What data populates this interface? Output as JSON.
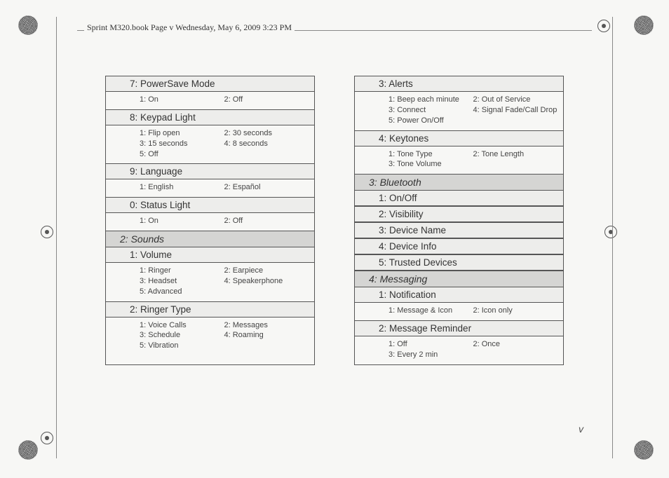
{
  "header": "Sprint M320.book  Page v  Wednesday, May 6, 2009  3:23 PM",
  "page_number": "v",
  "left": {
    "subs_top": [
      {
        "label": "7: PowerSave Mode",
        "opts": [
          "1: On",
          "2: Off"
        ]
      },
      {
        "label": "8: Keypad Light",
        "opts": [
          "1: Flip open",
          "2: 30 seconds",
          "3: 15 seconds",
          "4: 8 seconds",
          "5: Off"
        ]
      },
      {
        "label": "9: Language",
        "opts": [
          "1: English",
          "2: Español"
        ]
      },
      {
        "label": "0: Status Light",
        "opts": [
          "1: On",
          "2: Off"
        ]
      }
    ],
    "section": {
      "label": "2: Sounds"
    },
    "subs_bot": [
      {
        "label": "1: Volume",
        "opts": [
          "1: Ringer",
          "2: Earpiece",
          "3: Headset",
          "4: Speakerphone",
          "5: Advanced"
        ]
      },
      {
        "label": "2: Ringer Type",
        "opts": [
          "1: Voice Calls",
          "2: Messages",
          "3: Schedule",
          "4: Roaming",
          "5: Vibration"
        ]
      }
    ]
  },
  "right": {
    "subs_top": [
      {
        "label": "3: Alerts",
        "opts": [
          "1: Beep each minute",
          "2: Out of Service",
          "3: Connect",
          "4: Signal Fade/Call Drop",
          "5: Power On/Off"
        ]
      },
      {
        "label": "4: Keytones",
        "opts": [
          "1: Tone Type",
          "2: Tone Length",
          "3: Tone Volume"
        ]
      }
    ],
    "section_bt": {
      "label": "3: Bluetooth"
    },
    "bt_subs": [
      {
        "label": "1: On/Off"
      },
      {
        "label": "2: Visibility"
      },
      {
        "label": "3: Device Name"
      },
      {
        "label": "4: Device Info"
      },
      {
        "label": "5: Trusted Devices"
      }
    ],
    "section_msg": {
      "label": "4: Messaging"
    },
    "msg_subs": [
      {
        "label": "1: Notification",
        "opts": [
          "1: Message & Icon",
          "2: Icon only"
        ]
      },
      {
        "label": "2: Message Reminder",
        "opts": [
          "1: Off",
          "2: Once",
          "3: Every 2 min"
        ]
      }
    ]
  }
}
